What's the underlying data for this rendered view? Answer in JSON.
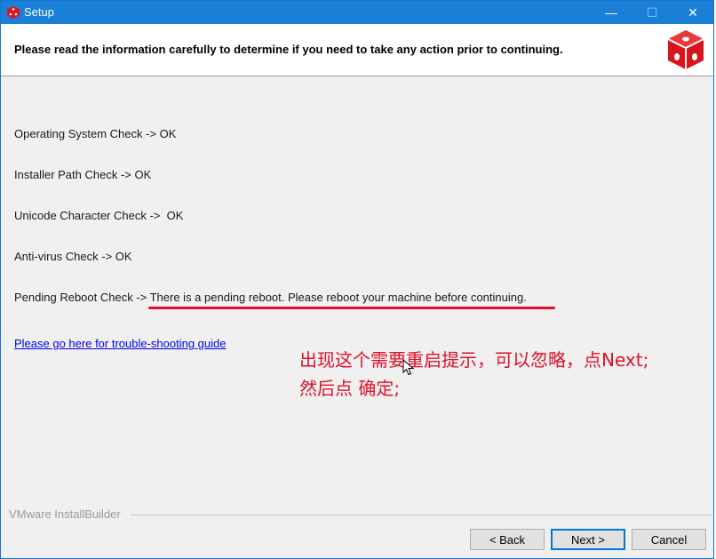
{
  "window": {
    "title": "Setup",
    "minimize": "—",
    "maximize": "☐",
    "close": "✕"
  },
  "header": {
    "text": "Please read the information carefully to determine if you need to take any action prior to continuing."
  },
  "checks": [
    {
      "text": "Operating System Check -> OK"
    },
    {
      "text": "Installer Path Check -> OK"
    },
    {
      "text": "Unicode Character Check ->  OK"
    },
    {
      "text": "Anti-virus Check -> OK"
    },
    {
      "text": "Pending Reboot Check -> There is a pending reboot. Please reboot your machine before continuing."
    }
  ],
  "help_link": "Please go here for trouble-shooting guide",
  "annotation": {
    "line1": "出现这个需要重启提示，可以忽略，点Next;",
    "line2": "然后点 确定;"
  },
  "footer": {
    "brand": "VMware InstallBuilder"
  },
  "buttons": {
    "back": "< Back",
    "next": "Next >",
    "cancel": "Cancel"
  },
  "colors": {
    "titlebar": "#1a7fd6",
    "accent_red": "#e0102a",
    "link": "#0000ee"
  }
}
